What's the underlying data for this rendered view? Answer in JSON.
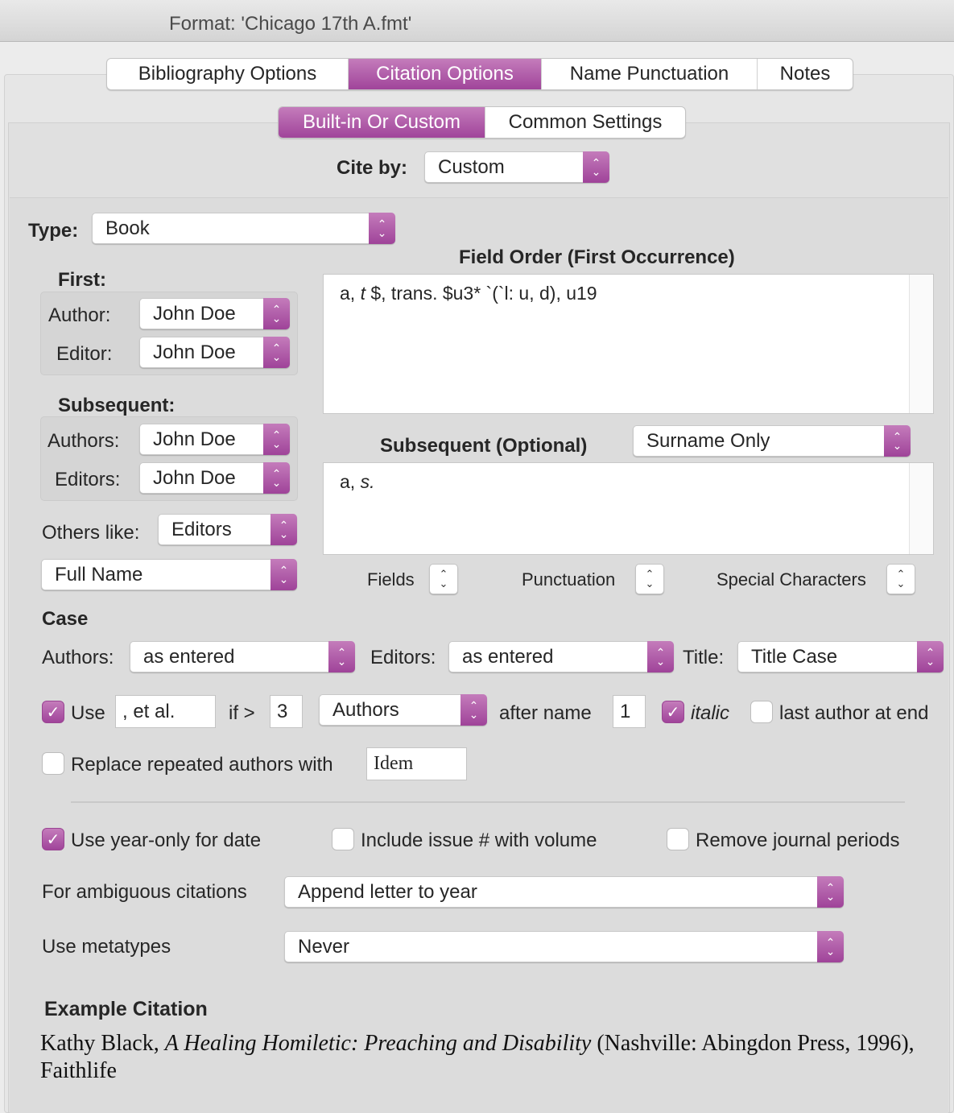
{
  "window": {
    "title": "Format: 'Chicago 17th A.fmt'"
  },
  "tabs": [
    {
      "label": "Bibliography Options",
      "active": false
    },
    {
      "label": "Citation Options",
      "active": true
    },
    {
      "label": "Name Punctuation",
      "active": false
    },
    {
      "label": "Notes",
      "active": false
    }
  ],
  "subtabs": [
    {
      "label": "Built-in Or Custom",
      "active": true
    },
    {
      "label": "Common Settings",
      "active": false
    }
  ],
  "cite_by": {
    "label": "Cite by:",
    "value": "Custom"
  },
  "type": {
    "label": "Type:",
    "value": "Book"
  },
  "first": {
    "heading": "First:",
    "author_label": "Author:",
    "author_value": "John Doe",
    "editor_label": "Editor:",
    "editor_value": "John Doe"
  },
  "subsequent": {
    "heading": "Subsequent:",
    "authors_label": "Authors:",
    "authors_value": "John Doe",
    "editors_label": "Editors:",
    "editors_value": "John Doe"
  },
  "others_like": {
    "label": "Others like:",
    "value": "Editors"
  },
  "name_form": {
    "value": "Full Name"
  },
  "field_order": {
    "heading": "Field Order (First Occurrence)",
    "pre": "a, ",
    "italic": "t",
    "post": " $, trans. $u3* `(`l: u, d), u19"
  },
  "subsequent_optional": {
    "heading": "Subsequent (Optional)",
    "mode": "Surname Only",
    "pre": "a, ",
    "italic": "s."
  },
  "inserters": {
    "fields": "Fields",
    "punctuation": "Punctuation",
    "special": "Special Characters"
  },
  "case": {
    "heading": "Case",
    "authors_label": "Authors:",
    "authors_value": "as entered",
    "editors_label": "Editors:",
    "editors_value": "as entered",
    "title_label": "Title:",
    "title_value": "Title Case"
  },
  "etal": {
    "use_checked": true,
    "use_label": "Use",
    "text": ", et al.",
    "if_label": "if >",
    "threshold": "3",
    "who": "Authors",
    "after_label": "after name",
    "after_value": "1",
    "italic_checked": true,
    "italic_label": "italic",
    "last_author_checked": false,
    "last_author_label": "last author at end"
  },
  "repeat": {
    "checked": false,
    "label": "Replace repeated authors with",
    "value": "Idem"
  },
  "options": {
    "year_only": {
      "checked": true,
      "label": "Use year-only for date"
    },
    "issue": {
      "checked": false,
      "label": "Include issue # with volume"
    },
    "periods": {
      "checked": false,
      "label": "Remove journal periods"
    }
  },
  "ambiguous": {
    "label": "For ambiguous citations",
    "value": "Append letter to year"
  },
  "metatypes": {
    "label": "Use metatypes",
    "value": "Never"
  },
  "example": {
    "heading": "Example Citation",
    "author": "Kathy Black, ",
    "title": "A Healing Homiletic: Preaching and Disability",
    "rest": " (Nashville: Abingdon Press, 1996),",
    "line2": "Faithlife"
  },
  "colors": {
    "accent": "#a8479f"
  }
}
